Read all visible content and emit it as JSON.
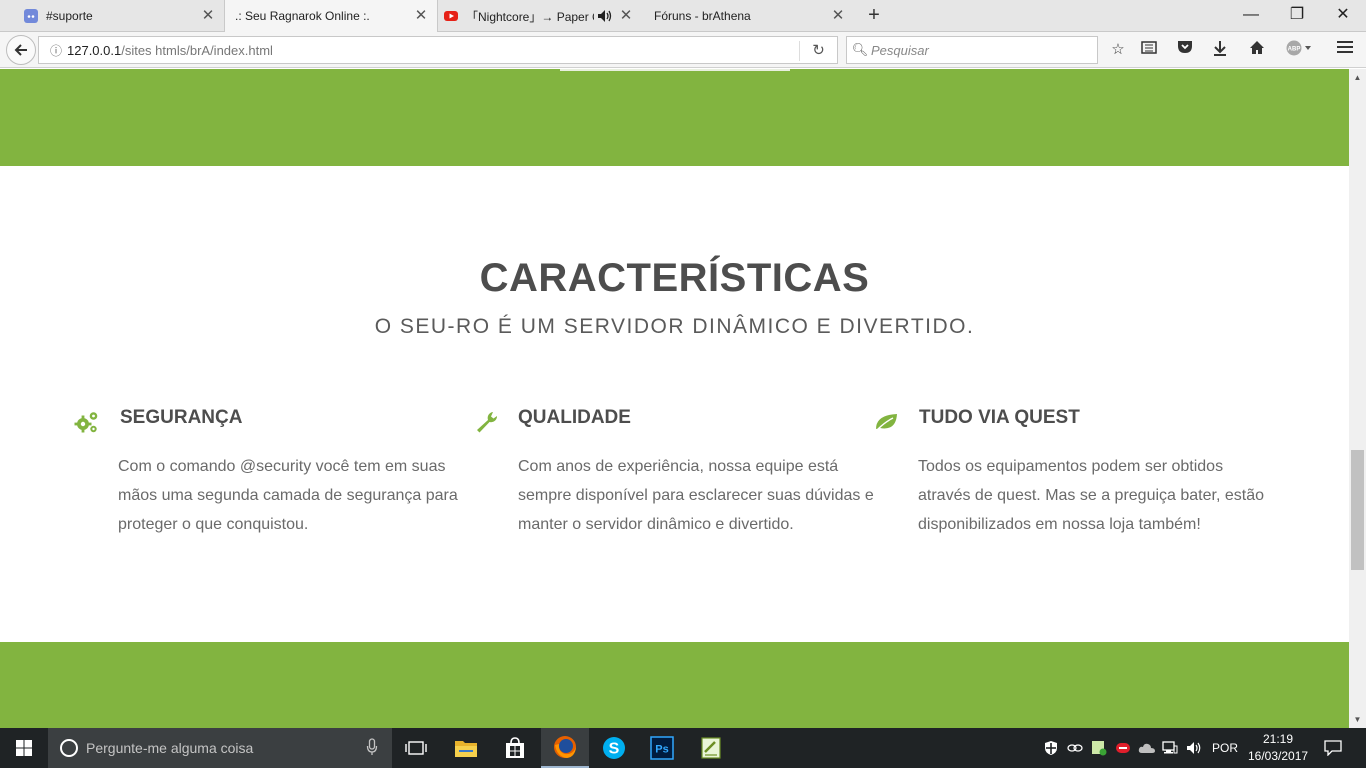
{
  "browser": {
    "tabs": [
      {
        "label": "#suporte",
        "icon": "discord-icon",
        "active": false
      },
      {
        "label": ".: Seu Ragnarok Online :.",
        "icon": "none",
        "active": true
      },
      {
        "label": "「Nightcore」→ Paper C...",
        "icon": "youtube-icon",
        "active": false,
        "audio": true
      },
      {
        "label": "Fóruns - brAthena",
        "icon": "none",
        "active": false
      }
    ],
    "close_glyph": "✕",
    "new_tab_glyph": "+",
    "window_controls": {
      "minimize": "—",
      "maximize": "❐",
      "close": "✕"
    },
    "url": {
      "host": "127.0.0.1",
      "path": "/sites htmls/brA/index.html"
    },
    "search_placeholder": "Pesquisar",
    "toolbar_icons": [
      "bookmark-star-icon",
      "reading-list-icon",
      "pocket-icon",
      "download-icon",
      "home-icon",
      "adblock-icon",
      "menu-icon"
    ]
  },
  "page": {
    "heading": "CARACTERÍSTICAS",
    "subheading": "O SEU-RO É UM SERVIDOR DINÂMICO E DIVERTIDO.",
    "features": [
      {
        "icon": "gears-icon",
        "title": "SEGURANÇA",
        "text": "Com o comando @security você tem em suas mãos uma segunda camada de segurança para proteger o que conquistou."
      },
      {
        "icon": "wrench-icon",
        "title": "QUALIDADE",
        "text": "Com anos de experiência, nossa equipe está sempre disponível para esclarecer suas dúvidas e manter o servidor dinâmico e divertido."
      },
      {
        "icon": "leaf-icon",
        "title": "TUDO VIA QUEST",
        "text": "Todos os equipamentos podem ser obtidos através de quest. Mas se a preguiça bater, estão disponibilizados em nossa loja também!"
      }
    ],
    "accent_color": "#82b440",
    "heading_color": "#4d4d4d"
  },
  "taskbar": {
    "search_placeholder": "Pergunte-me alguma coisa",
    "apps": [
      "task-view-icon",
      "file-explorer-icon",
      "store-icon",
      "firefox-icon",
      "skype-icon",
      "photoshop-icon",
      "notepadpp-icon"
    ],
    "language": "POR",
    "time": "21:19",
    "date": "16/03/2017"
  }
}
